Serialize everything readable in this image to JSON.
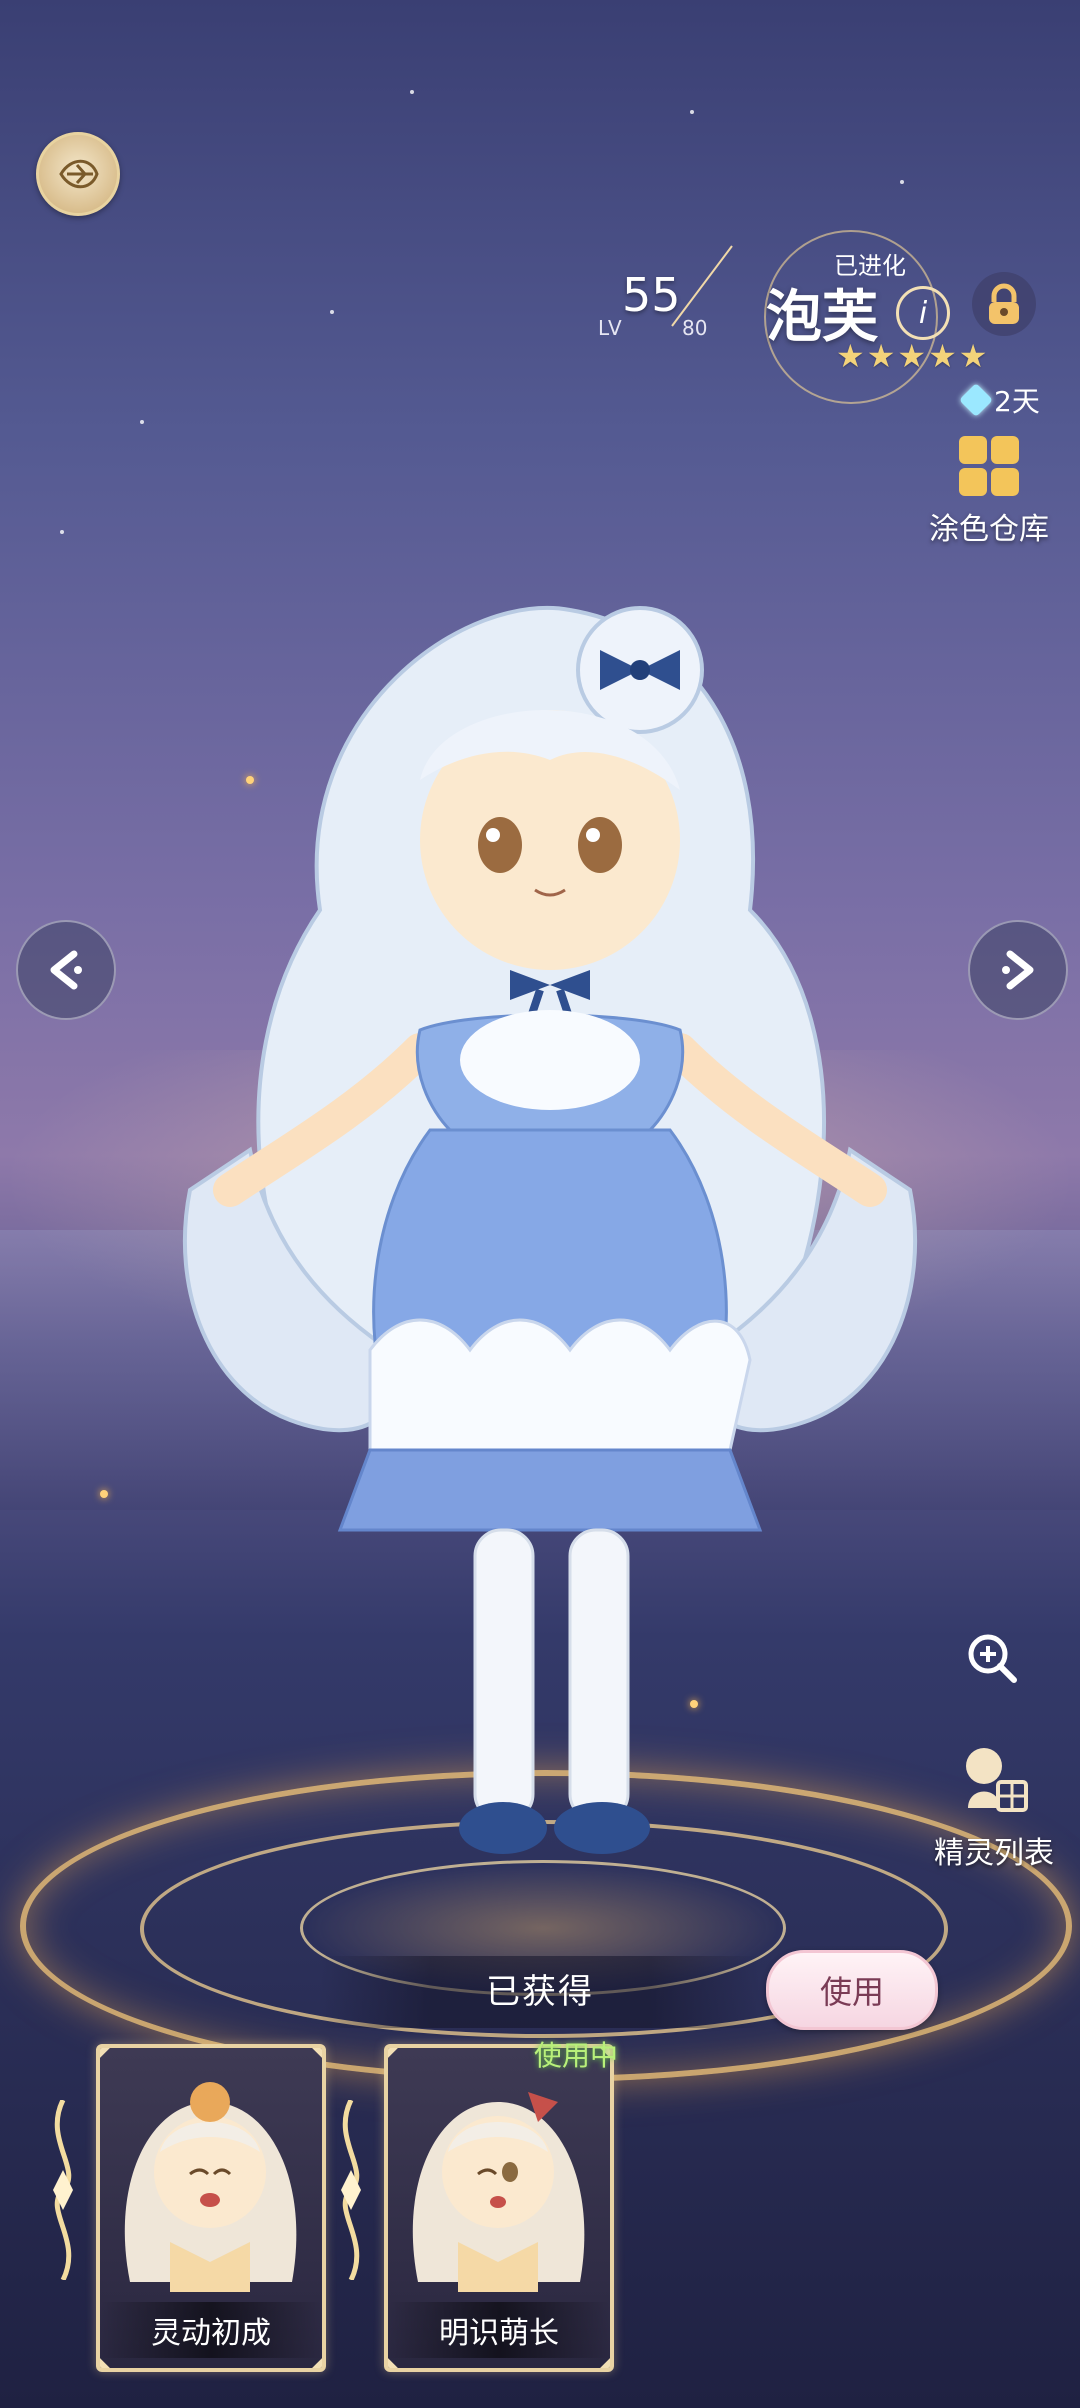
{
  "header": {
    "level": "55",
    "level_label": "LV",
    "level_max": "80",
    "status": "已进化",
    "name": "泡芙",
    "rarity_stars": 5,
    "days_text": "2天"
  },
  "side": {
    "paint_warehouse": "涂色仓库",
    "sprite_list": "精灵列表"
  },
  "outfit": {
    "status": "已获得",
    "use_button": "使用",
    "in_use_tag": "使用中",
    "cards": [
      {
        "label": "灵动初成"
      },
      {
        "label": "明识萌长"
      }
    ]
  },
  "icons": {
    "emblem": "leaf-emblem-icon",
    "info": "info-icon",
    "lock": "lock-icon",
    "prev": "chevron-left-icon",
    "next": "chevron-right-icon",
    "zoom": "zoom-in-icon",
    "sprite_list": "sprite-list-icon",
    "paint": "paint-grid-icon"
  },
  "colors": {
    "gold": "#f3d37a",
    "in_use": "#b8f07a",
    "use_button_text": "#7a3b55"
  }
}
